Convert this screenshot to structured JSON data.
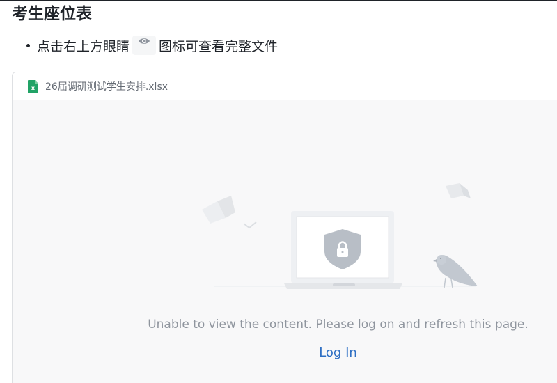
{
  "page": {
    "title": "考生座位表",
    "instruction_before": "点击右上方眼睛",
    "instruction_after": "图标可查看完整文件"
  },
  "file": {
    "name": "26届调研测试学生安排.xlsx",
    "icon": "excel-file-icon",
    "icon_color": "#21a366"
  },
  "preview": {
    "message": "Unable to view the content. Please log on and refresh this page.",
    "login_label": "Log In",
    "login_color": "#2e6fc4"
  }
}
